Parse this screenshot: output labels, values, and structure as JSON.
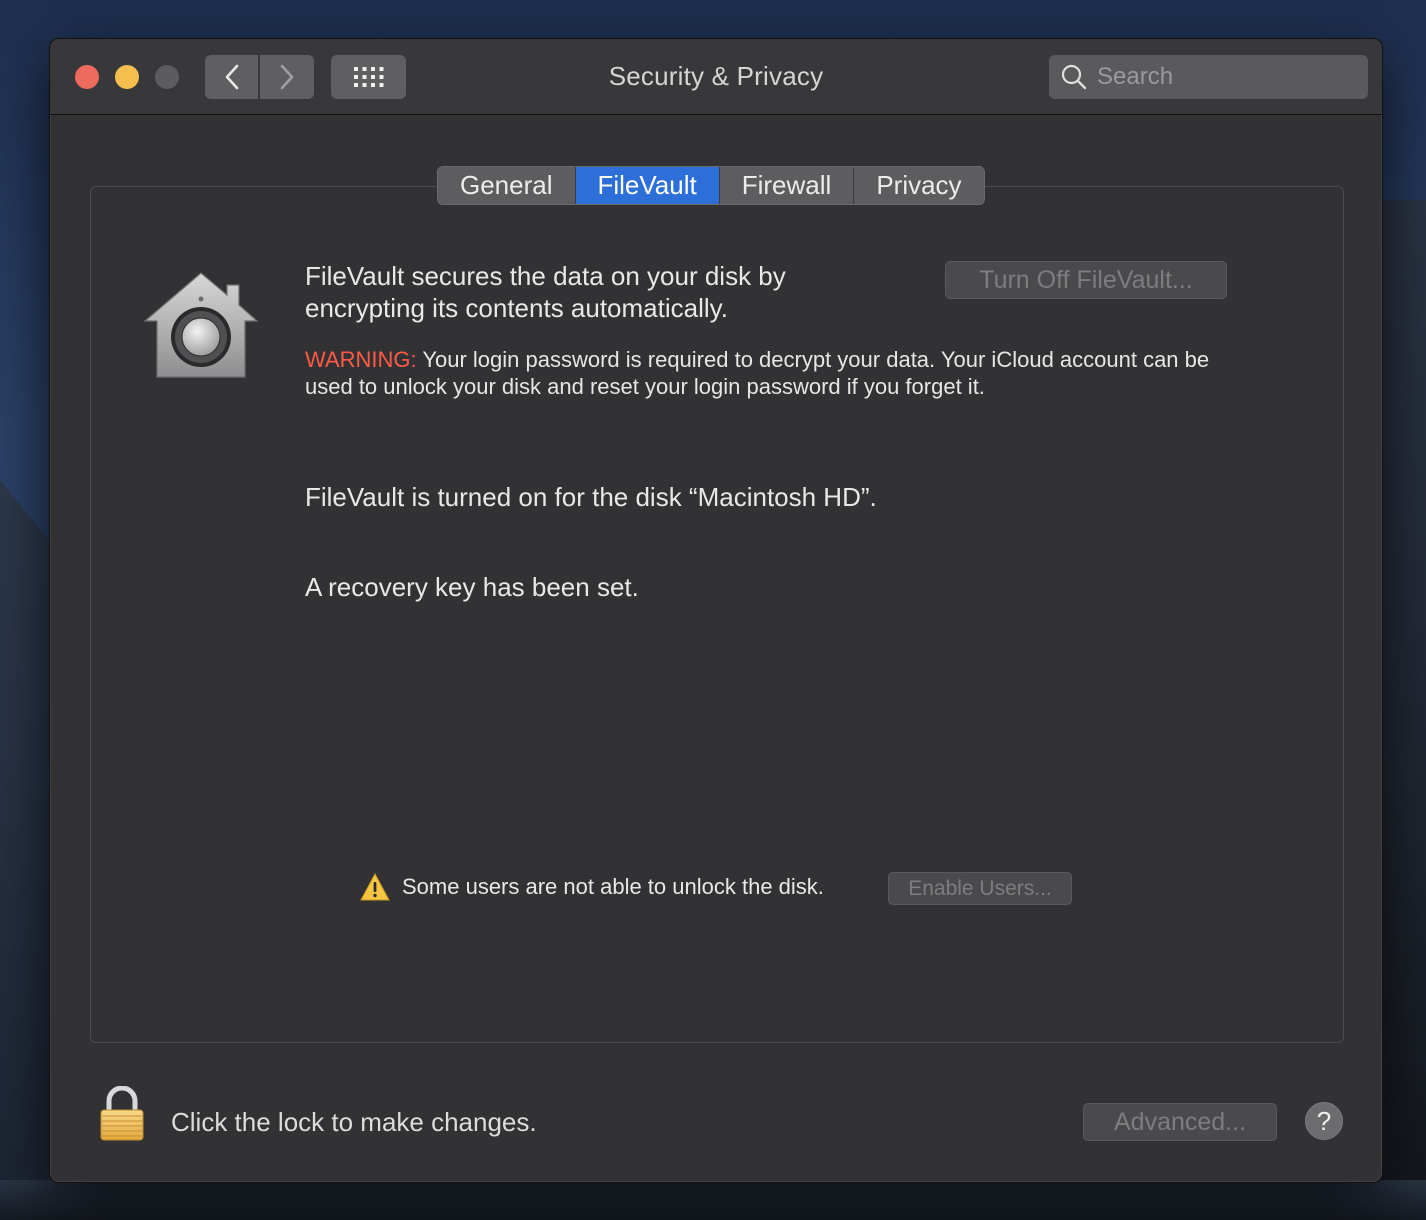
{
  "window": {
    "title": "Security & Privacy"
  },
  "toolbar": {
    "back_icon": "chevron-left-icon",
    "forward_icon": "chevron-right-icon",
    "grid_icon": "grid-icon"
  },
  "search": {
    "placeholder": "Search",
    "value": ""
  },
  "tabs": [
    {
      "label": "General",
      "active": false
    },
    {
      "label": "FileVault",
      "active": true
    },
    {
      "label": "Firewall",
      "active": false
    },
    {
      "label": "Privacy",
      "active": false
    }
  ],
  "filevault": {
    "description": "FileVault secures the data on your disk by encrypting its contents automatically.",
    "turn_off_label": "Turn Off FileVault...",
    "warning_label": "WARNING:",
    "warning_text": " Your login password is required to decrypt your data. Your iCloud account can be used to unlock your disk and reset your login password if you forget it.",
    "status_disk": "FileVault is turned on for the disk “Macintosh HD”.",
    "status_recovery": "A recovery key has been set.",
    "alert_text": "Some users are not able to unlock the disk.",
    "enable_users_label": "Enable Users..."
  },
  "footer": {
    "lock_text": "Click the lock to make changes.",
    "advanced_label": "Advanced...",
    "help_label": "?"
  },
  "colors": {
    "accent": "#2c6fd8",
    "warning": "#ff5a47",
    "close": "#ed6a5e",
    "minimize": "#f4bf4f"
  }
}
